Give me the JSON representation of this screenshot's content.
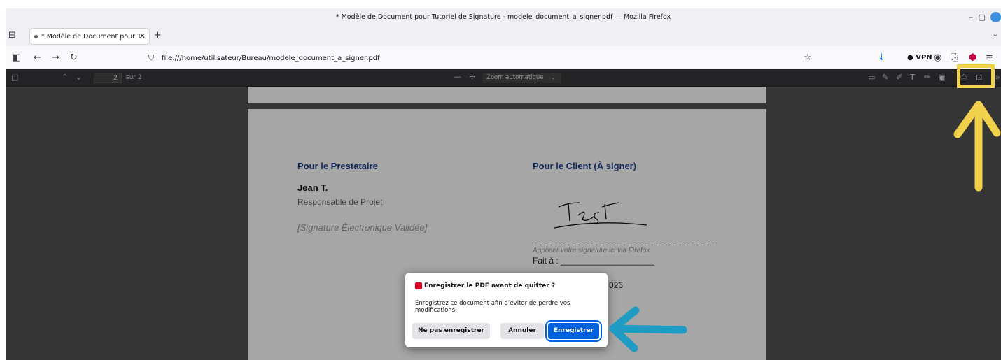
{
  "window": {
    "title": "* Modèle de Document pour Tutoriel de Signature - modele_document_a_signer.pdf — Mozilla Firefox"
  },
  "tab": {
    "label": "* Modèle de Document pour Tutoriel de Signature"
  },
  "navbar": {
    "url": "file:///home/utilisateur/Bureau/modele_document_a_signer.pdf",
    "vpn_label": "VPN"
  },
  "pdf_toolbar": {
    "page_number": "2",
    "page_of": "sur 2",
    "zoom": "Zoom automatique"
  },
  "document": {
    "provider_heading": "Pour le Prestataire",
    "provider_name": "Jean T.",
    "provider_role": "Responsable de Projet",
    "provider_signature": "[Signature Électronique Validée]",
    "client_heading": "Pour le Client (À signer)",
    "client_hint": "Apposer votre signature ici via Firefox",
    "client_place": "Fait à : ____________________",
    "client_date_partial": "026"
  },
  "dialog": {
    "title": "Enregistrer le PDF avant de quitter ?",
    "body": "Enregistrez ce document afin d’éviter de perdre vos modifications.",
    "dont_save": "Ne pas enregistrer",
    "cancel": "Annuler",
    "save": "Enregistrer"
  },
  "colors": {
    "highlight": "#f1d14b",
    "arrow_blue": "#1f9cc4",
    "primary": "#0061e0"
  }
}
